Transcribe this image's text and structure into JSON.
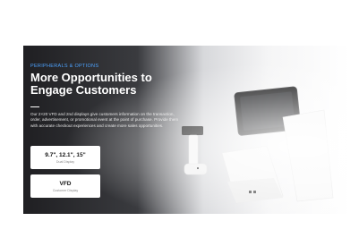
{
  "banner": {
    "eyebrow": "PERIPHERALS & OPTIONS",
    "headline_line1": "More Opportunities to",
    "headline_line2": "Engage Customers",
    "body": "Our 2×20 VFD and 2nd displays give customers information on the transaction, order, advertisement, or promotional event at the point of purchase. Provide them with accurate checkout experiences and create more sales opportunities.",
    "spec_cards": [
      {
        "title": "9.7\", 12.1\", 15\"",
        "subtitle": "Dual Display"
      },
      {
        "title": "VFD",
        "subtitle": "Customer Display"
      }
    ]
  },
  "colors": {
    "eyebrow": "#4da3ff",
    "headline": "#ffffff",
    "banner_dark": "#1f1f22"
  }
}
